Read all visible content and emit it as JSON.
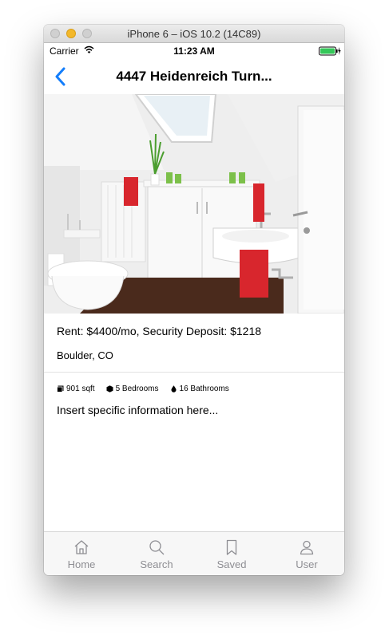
{
  "window": {
    "title": "iPhone 6 – iOS 10.2 (14C89)"
  },
  "status_bar": {
    "carrier": "Carrier",
    "time": "11:23 AM",
    "wifi_icon": "wifi-icon",
    "battery_icon": "battery-icon",
    "battery_color": "#35c759"
  },
  "nav": {
    "title": "4447 Heidenreich Turn...",
    "back_icon": "chevron-left-icon",
    "accent_color": "#147efb"
  },
  "listing": {
    "photo": "bathroom-photo",
    "rent": "Rent: $4400/mo, Security Deposit: $1218",
    "location": "Boulder, CO",
    "features": [
      {
        "icon": "square-icon",
        "label": "901 sqft"
      },
      {
        "icon": "cube-icon",
        "label": "5 Bedrooms"
      },
      {
        "icon": "drop-icon",
        "label": "16 Bathrooms"
      }
    ],
    "description": "Insert specific information here..."
  },
  "tabs": [
    {
      "label": "Home",
      "icon": "home-icon"
    },
    {
      "label": "Search",
      "icon": "search-icon"
    },
    {
      "label": "Saved",
      "icon": "bookmark-icon"
    },
    {
      "label": "User",
      "icon": "user-icon"
    }
  ]
}
